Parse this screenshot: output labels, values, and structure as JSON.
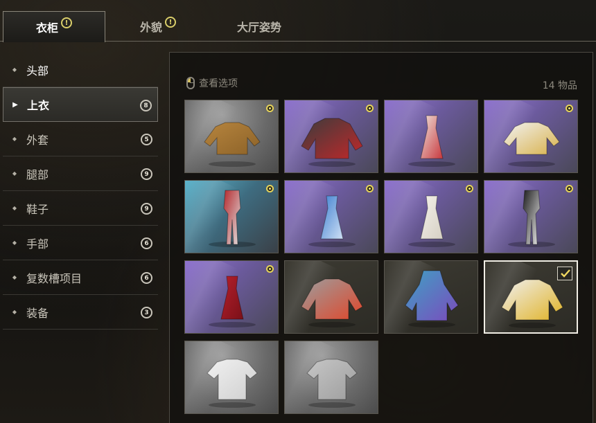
{
  "tabs": [
    {
      "label": "衣柜",
      "alert": "!"
    },
    {
      "label": "外貌",
      "alert": "!"
    },
    {
      "label": "大厅姿势"
    }
  ],
  "sidebar": {
    "items": [
      {
        "label": "头部",
        "bullet": "◆"
      },
      {
        "label": "上衣",
        "bullet": "▶",
        "count": "8"
      },
      {
        "label": "外套",
        "bullet": "◆",
        "count": "5"
      },
      {
        "label": "腿部",
        "bullet": "◆",
        "count": "9"
      },
      {
        "label": "鞋子",
        "bullet": "◆",
        "count": "9"
      },
      {
        "label": "手部",
        "bullet": "◆",
        "count": "6"
      },
      {
        "label": "复数槽项目",
        "bullet": "◆",
        "count": "6"
      },
      {
        "label": "装备",
        "bullet": "◆",
        "count": "3"
      }
    ]
  },
  "main": {
    "view_options_label": "查看选项",
    "view_options_icon": "mouse-icon",
    "item_count": "14 物品"
  },
  "items": [
    {
      "name": "mustard-sweater",
      "rarity_bg": "grey",
      "new": true,
      "colors": [
        "#b7853e",
        "#8c6228"
      ]
    },
    {
      "name": "racing-jacket",
      "rarity_bg": "purple",
      "new": true,
      "colors": [
        "#3c3c3c",
        "#c0282a"
      ]
    },
    {
      "name": "polka-dot-dress",
      "rarity_bg": "purple",
      "new": false,
      "colors": [
        "#efe4dc",
        "#c7383e"
      ]
    },
    {
      "name": "striped-sweatshirt",
      "rarity_bg": "purple",
      "new": true,
      "colors": [
        "#f2f2f2",
        "#d8b14a"
      ]
    },
    {
      "name": "red-bodysuit",
      "rarity_bg": "blue",
      "new": true,
      "colors": [
        "#b52b2f",
        "#e0e0e0"
      ]
    },
    {
      "name": "blue-dress",
      "rarity_bg": "purple",
      "new": true,
      "colors": [
        "#3e7fd0",
        "#cfe0f5"
      ]
    },
    {
      "name": "white-lace-dress",
      "rarity_bg": "purple",
      "new": true,
      "colors": [
        "#f4f1ea",
        "#d6d0c4"
      ]
    },
    {
      "name": "black-white-leotard",
      "rarity_bg": "purple",
      "new": true,
      "colors": [
        "#1e1e1e",
        "#e9e9e9"
      ]
    },
    {
      "name": "red-sequin-dress",
      "rarity_bg": "purple",
      "new": true,
      "colors": [
        "#b5202c",
        "#7a1018"
      ]
    },
    {
      "name": "grey-orange-jacket",
      "rarity_bg": "dark",
      "new": false,
      "colors": [
        "#9d9d9d",
        "#e0462a"
      ]
    },
    {
      "name": "blue-purple-hoodie",
      "rarity_bg": "dark",
      "new": false,
      "colors": [
        "#3fa1c4",
        "#7b4bbd"
      ]
    },
    {
      "name": "yellow-white-jacket",
      "rarity_bg": "dark",
      "new": false,
      "equipped": true,
      "colors": [
        "#f0f0f0",
        "#e0b224"
      ]
    },
    {
      "name": "white-tshirt",
      "rarity_bg": "grey",
      "new": false,
      "colors": [
        "#f1f1f1",
        "#cfcfcf"
      ]
    },
    {
      "name": "grey-tshirt",
      "rarity_bg": "grey",
      "new": false,
      "colors": [
        "#c6c6c6",
        "#9e9e9e"
      ]
    }
  ],
  "colors": {
    "alert_yellow": "#e3d76d",
    "selected_border": "#f2efe6",
    "purple_rarity": "#8f73cf",
    "blue_rarity": "#5db4cc"
  }
}
